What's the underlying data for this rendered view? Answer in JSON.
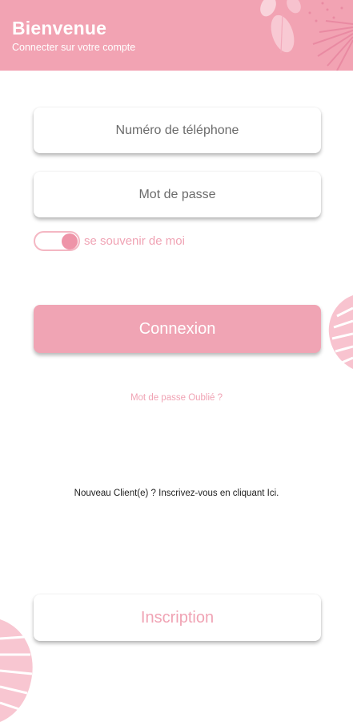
{
  "header": {
    "title": "Bienvenue",
    "subtitle": "Connecter sur votre compte"
  },
  "form": {
    "phone_placeholder": "Numéro de téléphone",
    "password_placeholder": "Mot de passe",
    "remember_label": "se souvenir de moi",
    "remember_checked": true
  },
  "actions": {
    "login_label": "Connexion",
    "forgot_label": "Mot de passe Oublié ?",
    "new_client_text": "Nouveau Client(e) ? Inscrivez-vous en cliquant Ici.",
    "signup_label": "Inscription"
  },
  "colors": {
    "brand_pink": "#f2a3b3",
    "text_pink": "#f0a3b4"
  },
  "decorations": [
    "leaf-icon",
    "palm-leaf-icon",
    "monstera-leaf-icon"
  ]
}
